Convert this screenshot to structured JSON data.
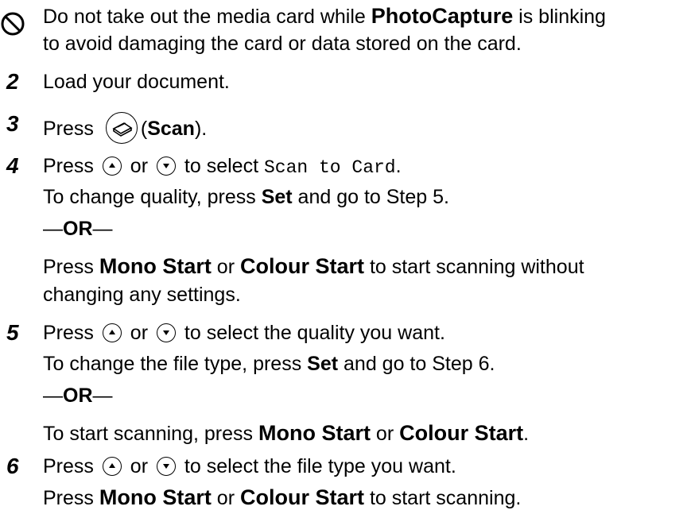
{
  "caution": {
    "line1_a": "Do not take out the media card while ",
    "line1_b": "PhotoCapture",
    "line1_c": " is blinking",
    "line2": "to avoid damaging the card or data stored on the card."
  },
  "steps": {
    "s2": {
      "num": "2",
      "text": "Load your document."
    },
    "s3": {
      "num": "3",
      "a": "Press ",
      "b": "(",
      "c": "Scan",
      "d": ")."
    },
    "s4": {
      "num": "4",
      "a": "Press ",
      "or": " or ",
      "b": " to select ",
      "mono": "Scan to Card",
      "c": ".",
      "l2a": "To change quality, press ",
      "l2b": "Set",
      "l2c": " and go to Step 5.",
      "orline_a": "—",
      "orline_b": "OR",
      "orline_c": "—",
      "l4a": "Press ",
      "l4b": "Mono Start",
      "l4c": " or ",
      "l4d": "Colour Start",
      "l4e": " to start scanning without",
      "l5": "changing any settings."
    },
    "s5": {
      "num": "5",
      "a": "Press ",
      "or": " or ",
      "b": " to select the quality you want.",
      "l2a": "To change the file type, press ",
      "l2b": "Set",
      "l2c": " and go to Step 6.",
      "orline_a": "—",
      "orline_b": "OR",
      "orline_c": "—",
      "l4a": "To start scanning, press ",
      "l4b": "Mono Start",
      "l4c": " or ",
      "l4d": "Colour Start",
      "l4e": "."
    },
    "s6": {
      "num": "6",
      "a": "Press ",
      "or": " or ",
      "b": " to select the file type you want.",
      "l2a": "Press ",
      "l2b": "Mono Start",
      "l2c": " or ",
      "l2d": "Colour Start",
      "l2e": " to start scanning."
    }
  }
}
